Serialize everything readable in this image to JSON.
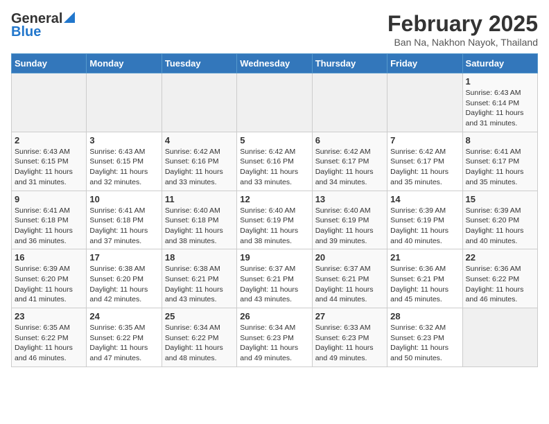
{
  "logo": {
    "general": "General",
    "blue": "Blue"
  },
  "header": {
    "month": "February 2025",
    "location": "Ban Na, Nakhon Nayok, Thailand"
  },
  "weekdays": [
    "Sunday",
    "Monday",
    "Tuesday",
    "Wednesday",
    "Thursday",
    "Friday",
    "Saturday"
  ],
  "weeks": [
    [
      {
        "day": "",
        "content": ""
      },
      {
        "day": "",
        "content": ""
      },
      {
        "day": "",
        "content": ""
      },
      {
        "day": "",
        "content": ""
      },
      {
        "day": "",
        "content": ""
      },
      {
        "day": "",
        "content": ""
      },
      {
        "day": "1",
        "content": "Sunrise: 6:43 AM\nSunset: 6:14 PM\nDaylight: 11 hours and 31 minutes."
      }
    ],
    [
      {
        "day": "2",
        "content": "Sunrise: 6:43 AM\nSunset: 6:15 PM\nDaylight: 11 hours and 31 minutes."
      },
      {
        "day": "3",
        "content": "Sunrise: 6:43 AM\nSunset: 6:15 PM\nDaylight: 11 hours and 32 minutes."
      },
      {
        "day": "4",
        "content": "Sunrise: 6:42 AM\nSunset: 6:16 PM\nDaylight: 11 hours and 33 minutes."
      },
      {
        "day": "5",
        "content": "Sunrise: 6:42 AM\nSunset: 6:16 PM\nDaylight: 11 hours and 33 minutes."
      },
      {
        "day": "6",
        "content": "Sunrise: 6:42 AM\nSunset: 6:17 PM\nDaylight: 11 hours and 34 minutes."
      },
      {
        "day": "7",
        "content": "Sunrise: 6:42 AM\nSunset: 6:17 PM\nDaylight: 11 hours and 35 minutes."
      },
      {
        "day": "8",
        "content": "Sunrise: 6:41 AM\nSunset: 6:17 PM\nDaylight: 11 hours and 35 minutes."
      }
    ],
    [
      {
        "day": "9",
        "content": "Sunrise: 6:41 AM\nSunset: 6:18 PM\nDaylight: 11 hours and 36 minutes."
      },
      {
        "day": "10",
        "content": "Sunrise: 6:41 AM\nSunset: 6:18 PM\nDaylight: 11 hours and 37 minutes."
      },
      {
        "day": "11",
        "content": "Sunrise: 6:40 AM\nSunset: 6:18 PM\nDaylight: 11 hours and 38 minutes."
      },
      {
        "day": "12",
        "content": "Sunrise: 6:40 AM\nSunset: 6:19 PM\nDaylight: 11 hours and 38 minutes."
      },
      {
        "day": "13",
        "content": "Sunrise: 6:40 AM\nSunset: 6:19 PM\nDaylight: 11 hours and 39 minutes."
      },
      {
        "day": "14",
        "content": "Sunrise: 6:39 AM\nSunset: 6:19 PM\nDaylight: 11 hours and 40 minutes."
      },
      {
        "day": "15",
        "content": "Sunrise: 6:39 AM\nSunset: 6:20 PM\nDaylight: 11 hours and 40 minutes."
      }
    ],
    [
      {
        "day": "16",
        "content": "Sunrise: 6:39 AM\nSunset: 6:20 PM\nDaylight: 11 hours and 41 minutes."
      },
      {
        "day": "17",
        "content": "Sunrise: 6:38 AM\nSunset: 6:20 PM\nDaylight: 11 hours and 42 minutes."
      },
      {
        "day": "18",
        "content": "Sunrise: 6:38 AM\nSunset: 6:21 PM\nDaylight: 11 hours and 43 minutes."
      },
      {
        "day": "19",
        "content": "Sunrise: 6:37 AM\nSunset: 6:21 PM\nDaylight: 11 hours and 43 minutes."
      },
      {
        "day": "20",
        "content": "Sunrise: 6:37 AM\nSunset: 6:21 PM\nDaylight: 11 hours and 44 minutes."
      },
      {
        "day": "21",
        "content": "Sunrise: 6:36 AM\nSunset: 6:21 PM\nDaylight: 11 hours and 45 minutes."
      },
      {
        "day": "22",
        "content": "Sunrise: 6:36 AM\nSunset: 6:22 PM\nDaylight: 11 hours and 46 minutes."
      }
    ],
    [
      {
        "day": "23",
        "content": "Sunrise: 6:35 AM\nSunset: 6:22 PM\nDaylight: 11 hours and 46 minutes."
      },
      {
        "day": "24",
        "content": "Sunrise: 6:35 AM\nSunset: 6:22 PM\nDaylight: 11 hours and 47 minutes."
      },
      {
        "day": "25",
        "content": "Sunrise: 6:34 AM\nSunset: 6:22 PM\nDaylight: 11 hours and 48 minutes."
      },
      {
        "day": "26",
        "content": "Sunrise: 6:34 AM\nSunset: 6:23 PM\nDaylight: 11 hours and 49 minutes."
      },
      {
        "day": "27",
        "content": "Sunrise: 6:33 AM\nSunset: 6:23 PM\nDaylight: 11 hours and 49 minutes."
      },
      {
        "day": "28",
        "content": "Sunrise: 6:32 AM\nSunset: 6:23 PM\nDaylight: 11 hours and 50 minutes."
      },
      {
        "day": "",
        "content": ""
      }
    ]
  ]
}
